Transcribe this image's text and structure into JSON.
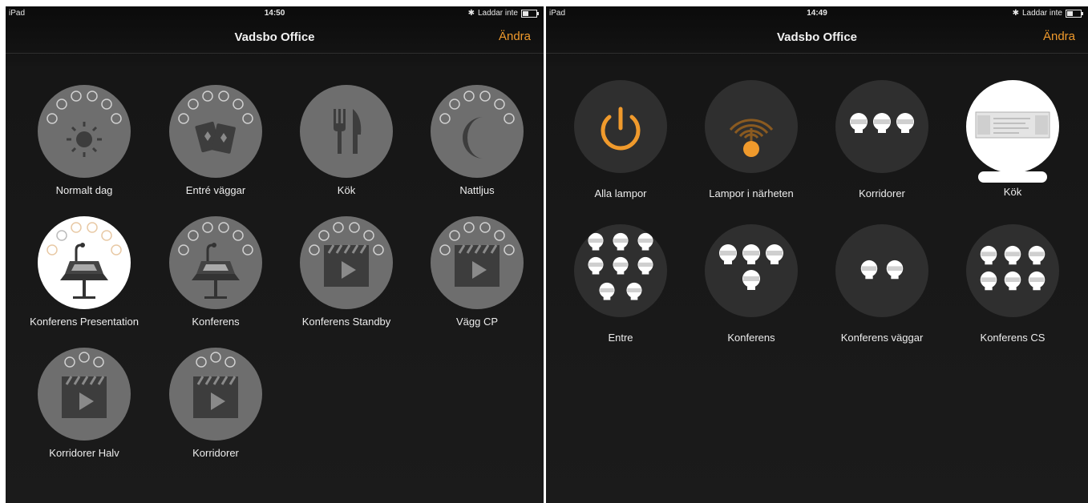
{
  "left_screen": {
    "status": {
      "device": "iPad",
      "time": "14:50",
      "battery_text": "Laddar inte"
    },
    "nav": {
      "title": "Vadsbo Office",
      "edit": "Ändra"
    },
    "scenes": [
      {
        "label": "Normalt dag",
        "icon": "sun-icon",
        "style": "grey"
      },
      {
        "label": "Entré väggar",
        "icon": "playing-cards-icon",
        "style": "grey"
      },
      {
        "label": "Kök",
        "icon": "fork-knife-icon",
        "style": "grey"
      },
      {
        "label": "Nattljus",
        "icon": "moon-icon",
        "style": "grey"
      },
      {
        "label": "Konferens Presentation",
        "icon": "conference-table-icon",
        "style": "white"
      },
      {
        "label": "Konferens",
        "icon": "conference-table-icon",
        "style": "grey"
      },
      {
        "label": "Konferens Standby",
        "icon": "clapperboard-icon",
        "style": "grey"
      },
      {
        "label": "Vägg CP",
        "icon": "clapperboard-icon",
        "style": "grey"
      },
      {
        "label": "Korridorer Halv",
        "icon": "clapperboard-icon",
        "style": "grey"
      },
      {
        "label": "Korridorer",
        "icon": "clapperboard-icon",
        "style": "grey"
      }
    ]
  },
  "right_screen": {
    "status": {
      "device": "iPad",
      "time": "14:49",
      "battery_text": "Laddar inte"
    },
    "nav": {
      "title": "Vadsbo Office",
      "edit": "Ändra"
    },
    "groups": [
      {
        "label": "Alla lampor",
        "icon": "power-icon",
        "color": "#f09a2c"
      },
      {
        "label": "Lampor i närheten",
        "icon": "proximity-signal-icon",
        "color": "#f09a2c"
      },
      {
        "label": "Korridorer",
        "icon": "lamp-group-icon",
        "lamp_count": 3
      },
      {
        "label": "Kök",
        "icon": "driver-device-icon"
      },
      {
        "label": "Entre",
        "icon": "lamp-group-icon",
        "lamp_count": 8
      },
      {
        "label": "Konferens",
        "icon": "lamp-group-icon",
        "lamp_count": 4
      },
      {
        "label": "Konferens väggar",
        "icon": "lamp-group-icon",
        "lamp_count": 2
      },
      {
        "label": "Konferens CS",
        "icon": "lamp-group-icon",
        "lamp_count": 6
      }
    ]
  }
}
